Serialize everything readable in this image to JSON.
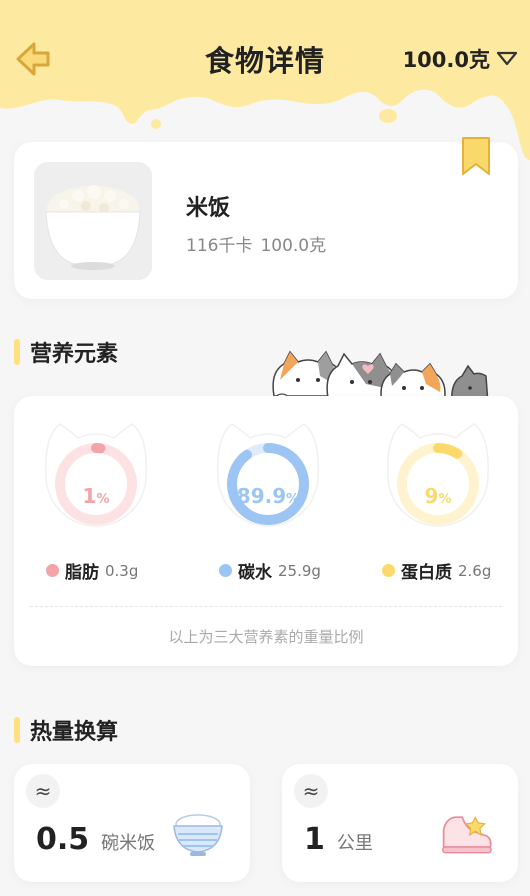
{
  "header": {
    "title": "食物详情",
    "weight_label": "100.0克",
    "accent_color": "#fdeaa0"
  },
  "food": {
    "name": "米饭",
    "calories": "116千卡",
    "weight": "100.0克"
  },
  "nutrients_section": {
    "title": "营养元素",
    "items": [
      {
        "name": "脂肪",
        "amount": "0.3g",
        "percent_num": "1",
        "percent_sign": "%",
        "percent": 1,
        "color": "#f3a4a8",
        "track": "#fde2e3"
      },
      {
        "name": "碳水",
        "amount": "25.9g",
        "percent_num": "89.9",
        "percent_sign": "%",
        "percent": 89.9,
        "color": "#9cc5f4",
        "track": "#dfeafb"
      },
      {
        "name": "蛋白质",
        "amount": "2.6g",
        "percent_num": "9",
        "percent_sign": "%",
        "percent": 9,
        "color": "#fbd96a",
        "track": "#fff3cf"
      }
    ],
    "note": "以上为三大营养素的重量比例"
  },
  "calorie_section": {
    "title": "热量换算",
    "cards": [
      {
        "approx": "≈",
        "value": "0.5",
        "unit": "碗米饭",
        "icon": "rice-bowl-icon"
      },
      {
        "approx": "≈",
        "value": "1",
        "unit": "公里",
        "icon": "sneaker-icon"
      }
    ]
  }
}
